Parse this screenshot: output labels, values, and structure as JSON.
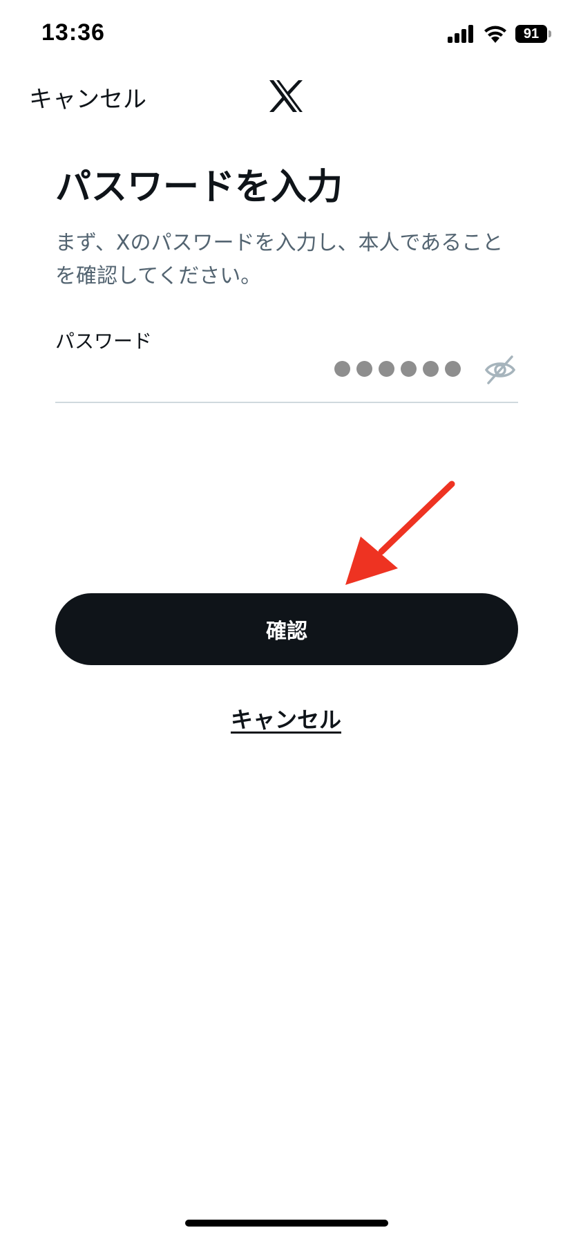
{
  "status_bar": {
    "time": "13:36",
    "battery_level": "91",
    "icons": [
      "signal-icon",
      "wifi-icon",
      "battery-icon"
    ]
  },
  "header": {
    "cancel_label": "キャンセル",
    "logo": "x-logo-icon"
  },
  "main": {
    "title": "パスワードを入力",
    "subtitle": "まず、Xのパスワードを入力し、本人であることを確認してください。",
    "password_field": {
      "label": "パスワード",
      "value_masked_length": 6,
      "toggle_icon": "eye-slash-icon"
    },
    "confirm_label": "確認",
    "cancel_label": "キャンセル"
  },
  "annotation": {
    "arrow_color": "#ee3322"
  },
  "colors": {
    "primary_text": "#0f1419",
    "secondary_text": "#536471",
    "button_bg": "#0f1419",
    "divider": "#cfd9de"
  }
}
